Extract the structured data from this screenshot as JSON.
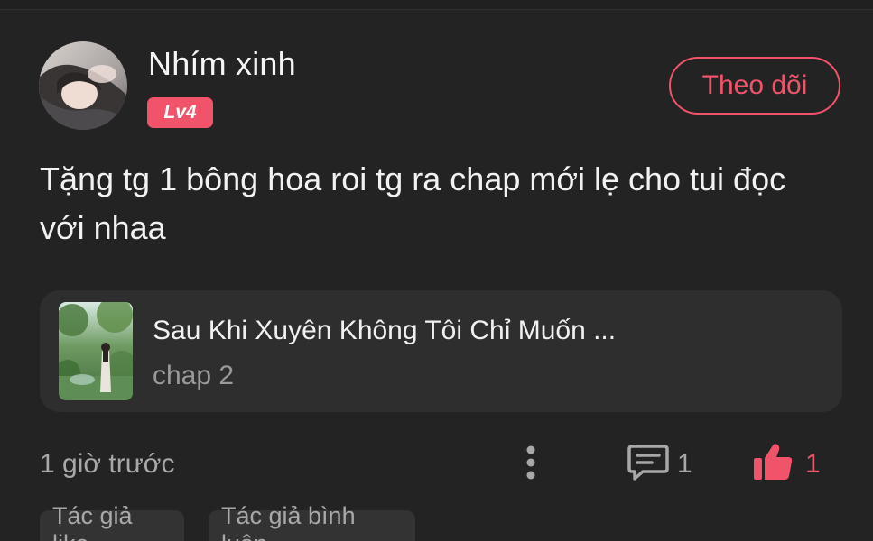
{
  "user": {
    "name": "Nhím xinh",
    "level": "Lv4"
  },
  "follow_label": "Theo dõi",
  "comment": {
    "text": "Tặng tg 1 bông hoa roi tg ra chap mới lẹ cho tui đọc với nhaa"
  },
  "story": {
    "title": "Sau Khi Xuyên Không Tôi Chỉ Muốn ...",
    "chapter": "chap 2"
  },
  "footer": {
    "timestamp": "1 giờ trước",
    "reply_count": "1",
    "like_count": "1"
  },
  "tags": [
    {
      "label": "Tác giả like"
    },
    {
      "label": "Tác giả bình luận"
    }
  ],
  "icons": {
    "more": "more-vertical-icon",
    "comment": "comment-icon",
    "like": "thumbs-up-icon"
  },
  "colors": {
    "background": "#232323",
    "accent": "#f0536a",
    "card": "#2e2e2e",
    "muted_text": "#a8a8a8"
  }
}
